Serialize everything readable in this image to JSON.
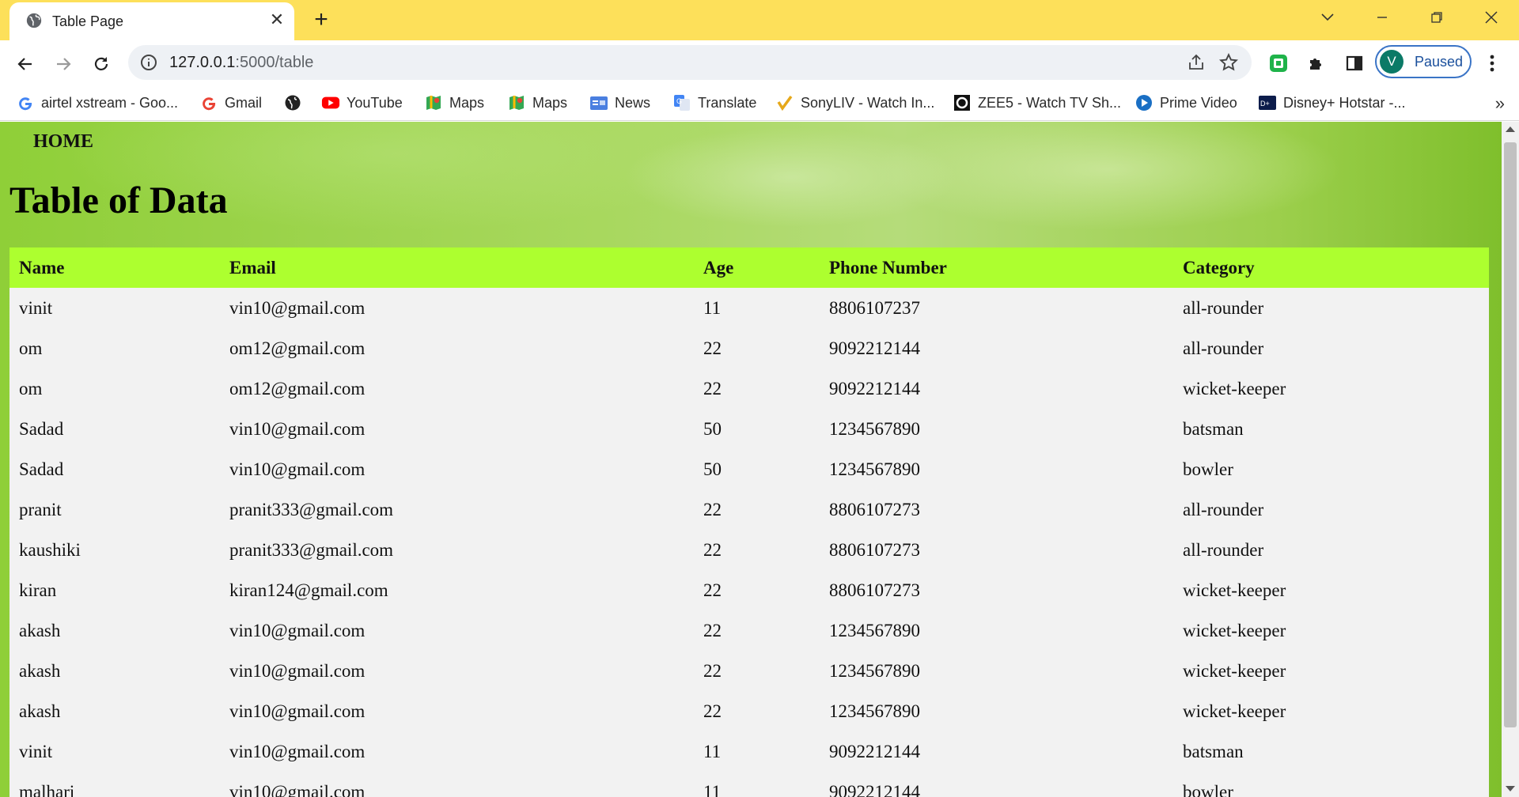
{
  "browser": {
    "tab": {
      "title": "Table Page",
      "close_glyph": "✕",
      "favicon": "globe-icon"
    },
    "new_tab_glyph": "+",
    "url_host": "127.0.0.1",
    "url_path": ":5000/table",
    "profile": {
      "initial": "V",
      "status": "Paused",
      "color": "#0b7a67"
    },
    "accent_color": "#fde05a"
  },
  "bookmarks": [
    {
      "label": "airtel xstream - Goo...",
      "icon": "google-icon"
    },
    {
      "label": "Gmail",
      "icon": "google-icon"
    },
    {
      "label": "",
      "icon": "globe-icon"
    },
    {
      "label": "YouTube",
      "icon": "youtube-icon"
    },
    {
      "label": "Maps",
      "icon": "maps-icon"
    },
    {
      "label": "Maps",
      "icon": "maps-icon"
    },
    {
      "label": "News",
      "icon": "news-icon"
    },
    {
      "label": "Translate",
      "icon": "translate-icon"
    },
    {
      "label": "SonyLIV - Watch In...",
      "icon": "sonyliv-icon"
    },
    {
      "label": "ZEE5 - Watch TV Sh...",
      "icon": "zee5-icon"
    },
    {
      "label": "Prime Video",
      "icon": "prime-video-icon"
    },
    {
      "label": "Disney+ Hotstar -...",
      "icon": "hotstar-icon"
    }
  ],
  "page": {
    "nav_home": "HOME",
    "title": "Table of Data",
    "header_color": "#adff2f",
    "columns": [
      "Name",
      "Email",
      "Age",
      "Phone Number",
      "Category"
    ],
    "rows": [
      [
        "vinit",
        "vin10@gmail.com",
        "11",
        "8806107237",
        "all-rounder"
      ],
      [
        "om",
        "om12@gmail.com",
        "22",
        "9092212144",
        "all-rounder"
      ],
      [
        "om",
        "om12@gmail.com",
        "22",
        "9092212144",
        "wicket-keeper"
      ],
      [
        "Sadad",
        "vin10@gmail.com",
        "50",
        "1234567890",
        "batsman"
      ],
      [
        "Sadad",
        "vin10@gmail.com",
        "50",
        "1234567890",
        "bowler"
      ],
      [
        "pranit",
        "pranit333@gmail.com",
        "22",
        "8806107273",
        "all-rounder"
      ],
      [
        "kaushiki",
        "pranit333@gmail.com",
        "22",
        "8806107273",
        "all-rounder"
      ],
      [
        "kiran",
        "kiran124@gmail.com",
        "22",
        "8806107273",
        "wicket-keeper"
      ],
      [
        "akash",
        "vin10@gmail.com",
        "22",
        "1234567890",
        "wicket-keeper"
      ],
      [
        "akash",
        "vin10@gmail.com",
        "22",
        "1234567890",
        "wicket-keeper"
      ],
      [
        "akash",
        "vin10@gmail.com",
        "22",
        "1234567890",
        "wicket-keeper"
      ],
      [
        "vinit",
        "vin10@gmail.com",
        "11",
        "9092212144",
        "batsman"
      ],
      [
        "malhari",
        "vin10@gmail.com",
        "11",
        "9092212144",
        "bowler"
      ]
    ]
  }
}
